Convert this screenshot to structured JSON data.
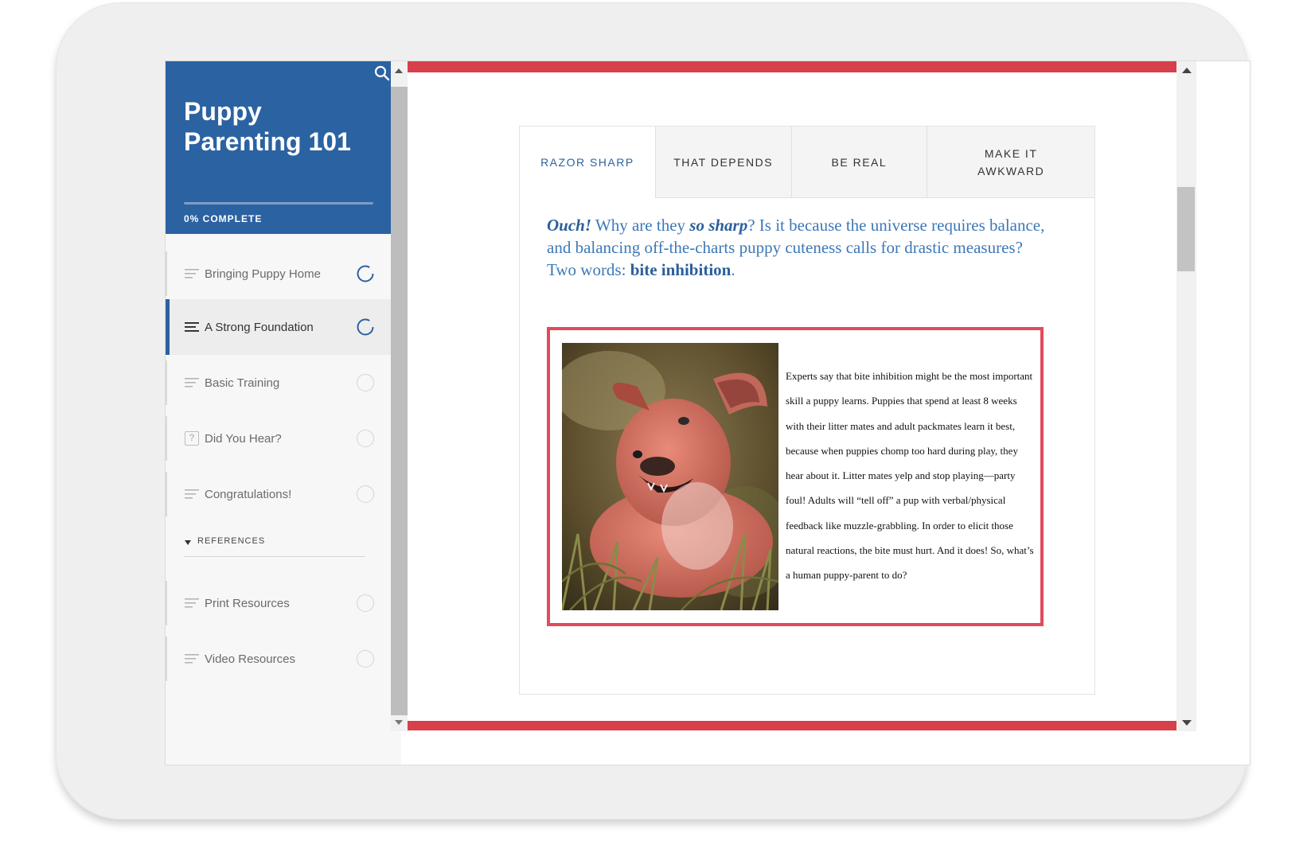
{
  "sidebar": {
    "course_title": "Puppy Parenting 101",
    "progress_label": "0% COMPLETE",
    "progress": 0,
    "items": [
      {
        "label": "Bringing Puppy Home",
        "icon": "lines-icon",
        "status": "in-progress"
      },
      {
        "label": "A Strong Foundation",
        "icon": "lines-icon",
        "status": "in-progress",
        "active": true
      },
      {
        "label": "Basic Training",
        "icon": "lines-icon",
        "status": "not-started"
      },
      {
        "label": "Did You Hear?",
        "icon": "quiz-icon",
        "status": "not-started"
      },
      {
        "label": "Congratulations!",
        "icon": "lines-icon",
        "status": "not-started"
      }
    ],
    "references_label": "REFERENCES",
    "reference_items": [
      {
        "label": "Print Resources",
        "icon": "lines-icon",
        "status": "not-started"
      },
      {
        "label": "Video Resources",
        "icon": "lines-icon",
        "status": "not-started"
      }
    ]
  },
  "tabs": [
    {
      "label": "RAZOR SHARP",
      "active": true
    },
    {
      "label": "THAT DEPENDS"
    },
    {
      "label": "BE REAL"
    },
    {
      "label": "MAKE IT AWKWARD"
    }
  ],
  "content": {
    "lead_ouch": "Ouch!",
    "lead_part1": " Why are they ",
    "lead_so_sharp": "so sharp",
    "lead_part2": "? Is it because the universe requires balance, and balancing off-the-charts puppy cuteness calls for drastic measures?",
    "lead_part3": "Two words: ",
    "lead_bite": "bite inhibition",
    "lead_period": ".",
    "body": "Experts say that bite inhibition might be the most important skill a puppy learns. Puppies that spend at least 8 weeks with their litter mates and adult packmates learn it best, because when puppies chomp too hard during play, they hear about it. Litter mates yelp and stop playing—party foul! Adults will “tell off” a pup with verbal/physical feedback like muzzle-grabbling. In order to elicit those natural reactions, the bite must hurt. And it does! So, what’s a human puppy-parent to do?"
  },
  "colors": {
    "brand_blue": "#2b62a2",
    "accent_red": "#d7404b",
    "callout_border": "#e24b5b"
  }
}
